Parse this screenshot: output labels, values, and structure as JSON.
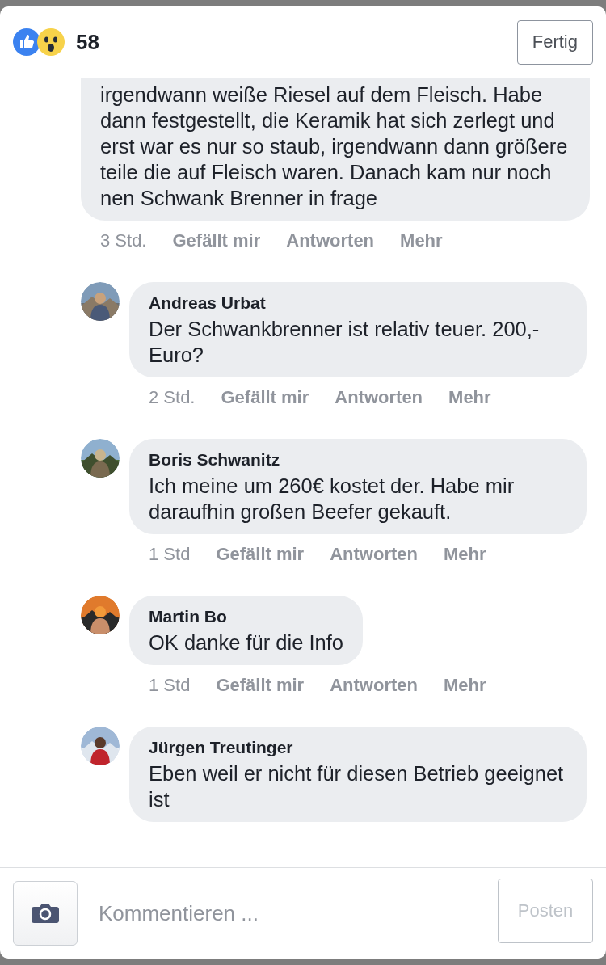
{
  "header": {
    "reaction_count": "58",
    "done_button": "Fertig"
  },
  "comments": [
    {
      "text": "irgendwann weiße Riesel auf dem Fleisch. Habe dann festgestellt, die Keramik hat sich zerlegt und erst war es nur so staub, irgendwann dann größere teile die auf Fleisch waren. Danach kam nur noch nen Schwank Brenner in frage",
      "time": "3 Std.",
      "actions": [
        "Gefällt mir",
        "Antworten",
        "Mehr"
      ]
    },
    {
      "author": "Andreas Urbat",
      "text": "Der Schwankbrenner ist relativ teuer. 200,- Euro?",
      "time": "2 Std.",
      "actions": [
        "Gefällt mir",
        "Antworten",
        "Mehr"
      ]
    },
    {
      "author": "Boris Schwanitz",
      "text": "Ich meine um 260€ kostet der. Habe mir daraufhin großen Beefer gekauft.",
      "time": "1 Std",
      "actions": [
        "Gefällt mir",
        "Antworten",
        "Mehr"
      ]
    },
    {
      "author": "Martin Bo",
      "text": "OK danke für die Info",
      "time": "1 Std",
      "actions": [
        "Gefällt mir",
        "Antworten",
        "Mehr"
      ]
    },
    {
      "author": "Jürgen Treutinger",
      "text": "Eben weil er nicht für diesen Betrieb geeignet ist"
    }
  ],
  "composer": {
    "placeholder": "Kommentieren ...",
    "post_button": {
      "label": "Posten",
      "disabled": true
    }
  }
}
